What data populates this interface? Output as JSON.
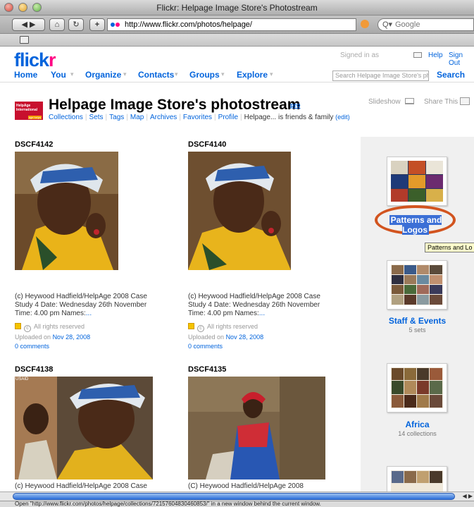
{
  "window": {
    "title": "Flickr: Helpage Image Store's Photostream"
  },
  "browser": {
    "url": "http://www.flickr.com/photos/helpage/",
    "search_placeholder": "Google"
  },
  "header": {
    "logo_main": "flick",
    "logo_accent": "r",
    "signed_in": "Signed in as",
    "help": "Help",
    "sign_out": "Sign Out"
  },
  "nav": {
    "items": [
      "Home",
      "You",
      "Organize",
      "Contacts",
      "Groups",
      "Explore"
    ],
    "search_placeholder": "Search Helpage Image Store's pho",
    "search_button": "Search"
  },
  "profile": {
    "buddy_line1": "HelpAge International",
    "buddy_line2": "age helps",
    "title": "Helpage Image Store's photostream",
    "pro": "pro",
    "links": [
      "Collections",
      "Sets",
      "Tags",
      "Map",
      "Archives",
      "Favorites",
      "Profile"
    ],
    "friends_text": "Helpage... is friends & family",
    "edit": "(edit)",
    "slideshow": "Slideshow",
    "share": "Share This"
  },
  "photos": [
    {
      "title": "DSCF4142",
      "caption": "(c) Heywood Hadfield/HelpAge 2008 Case Study 4 Date: Wednesday 26th November Time: 4.00 pm Names:",
      "more": "...",
      "rights": "All rights reserved",
      "uploaded_prefix": "Uploaded on",
      "uploaded_date": "Nov 28, 2008",
      "comments": "0 comments"
    },
    {
      "title": "DSCF4140",
      "caption": "(c) Heywood Hadfield/HelpAge 2008 Case Study 4 Date: Wednesday 26th November Time: 4.00 pm Names:",
      "more": "...",
      "rights": "All rights reserved",
      "uploaded_prefix": "Uploaded on",
      "uploaded_date": "Nov 28, 2008",
      "comments": "0 comments"
    },
    {
      "title": "DSCF4138",
      "caption": "(c) Heywood Hadfield/HelpAge 2008 Case",
      "usaid": "USAID"
    },
    {
      "title": "DSCF4135",
      "caption": "(C) Heywood Hadfield/HelpAge 2008"
    }
  ],
  "collections": [
    {
      "title": "Patterns and Logos",
      "tooltip": "Patterns and Lo"
    },
    {
      "title": "Staff & Events",
      "sub": "5 sets"
    },
    {
      "title": "Africa",
      "sub": "14 collections"
    }
  ],
  "status_bar": "Open \"http://www.flickr.com/photos/helpage/collections/72157604830460853/\" in a new window behind the current window."
}
